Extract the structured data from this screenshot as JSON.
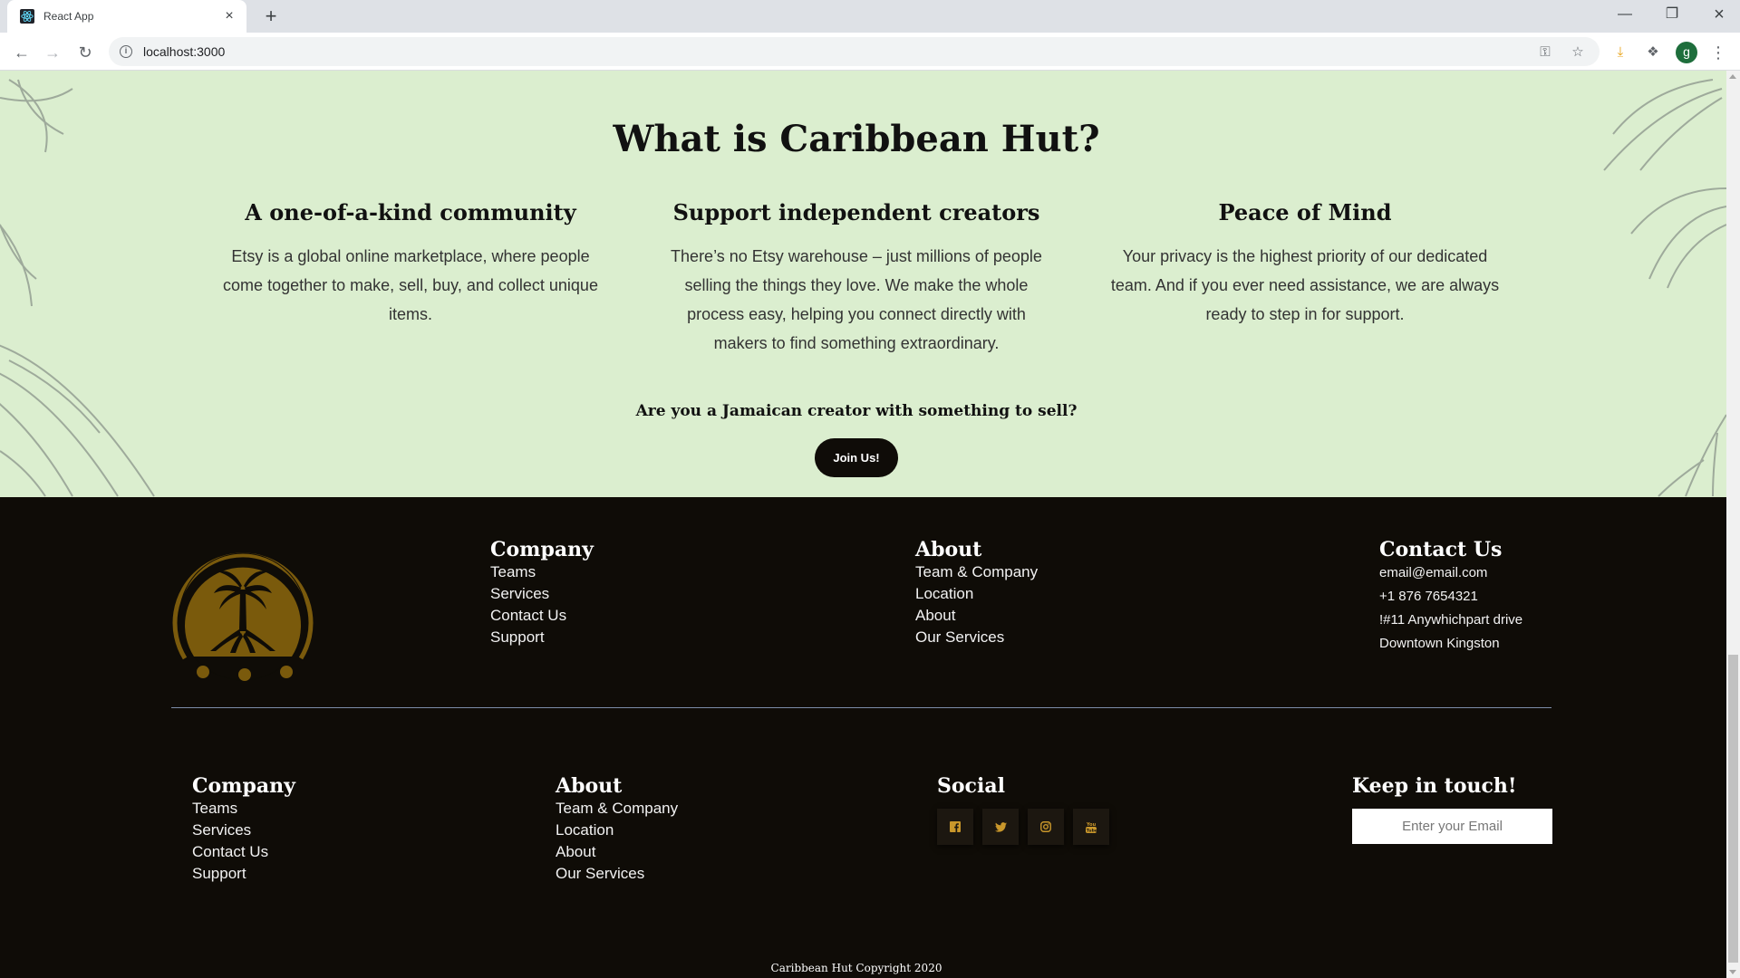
{
  "browser": {
    "tab_title": "React App",
    "url": "localhost:3000",
    "profile_initial": "g"
  },
  "hero": {
    "title": "What is Caribbean Hut?",
    "features": [
      {
        "title": "A one-of-a-kind community",
        "text": "Etsy is a global online marketplace, where people come together to make, sell, buy, and collect unique items."
      },
      {
        "title": "Support independent creators",
        "text": "There’s no Etsy warehouse – just millions of people selling the things they love. We make the whole process easy, helping you connect directly with makers to find something extraordinary."
      },
      {
        "title": "Peace of Mind",
        "text": "Your privacy is the highest priority of our dedicated team. And if you ever need assistance, we are always ready to step in for support."
      }
    ],
    "cta_question": "Are you a Jamaican creator with something to sell?",
    "cta_button": "Join Us!"
  },
  "footer": {
    "top": {
      "company": {
        "title": "Company",
        "links": [
          "Teams",
          "Services",
          "Contact Us",
          "Support"
        ]
      },
      "about": {
        "title": "About",
        "links": [
          "Team & Company",
          "Location",
          "About",
          "Our Services"
        ]
      },
      "contact": {
        "title": "Contact Us",
        "lines": [
          "email@email.com",
          "+1 876 7654321",
          "!#11 Anywhichpart drive",
          "Downtown Kingston"
        ]
      }
    },
    "bottom": {
      "company": {
        "title": "Company",
        "links": [
          "Teams",
          "Services",
          "Contact Us",
          "Support"
        ]
      },
      "about": {
        "title": "About",
        "links": [
          "Team & Company",
          "Location",
          "About",
          "Our Services"
        ]
      },
      "social": {
        "title": "Social",
        "icons": [
          "facebook-icon",
          "twitter-icon",
          "instagram-icon",
          "youtube-icon"
        ]
      },
      "newsletter": {
        "title": "Keep in touch!",
        "placeholder": "Enter your Email"
      }
    },
    "copyright": "Caribbean Hut Copyright 2020"
  },
  "colors": {
    "hero_bg": "#dbeecf",
    "footer_bg": "#0f0c07",
    "brand_gold": "#7a5a0c",
    "social_icon": "#c9972b"
  }
}
